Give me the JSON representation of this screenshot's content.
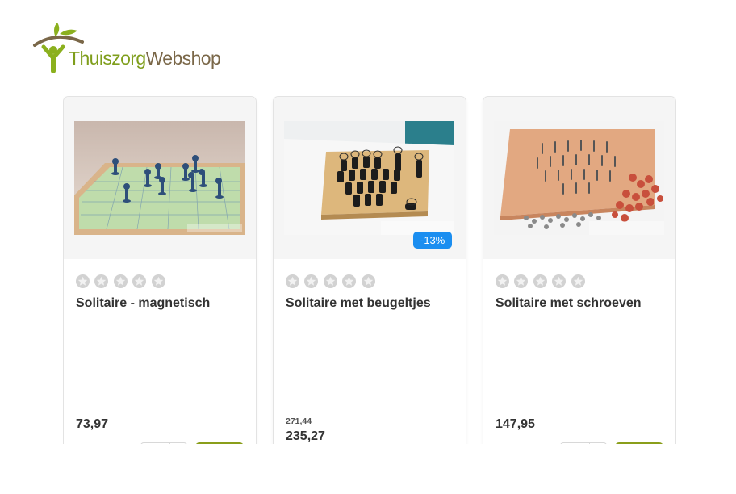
{
  "header": {
    "logo_part1": "Thuiszorg",
    "logo_part2": "Webshop"
  },
  "colors": {
    "brand_green": "#7f9e1c",
    "brand_brown": "#7a6748",
    "discount_badge": "#1b8ef0",
    "star_empty": "#d2d2d2",
    "cart_button": "#8a9e1a"
  },
  "products": [
    {
      "title": "Solitaire - magnetisch",
      "price": "73,97",
      "rating_stars": 0,
      "image": "magnetic-solitaire-board-photo"
    },
    {
      "title": "Solitaire met beugeltjes",
      "old_price": "271,44",
      "price": "235,27",
      "discount": "-13%",
      "rating_stars": 0,
      "image": "solitaire-with-handles-photo"
    },
    {
      "title": "Solitaire met schroeven",
      "price": "147,95",
      "rating_stars": 0,
      "image": "solitaire-with-screws-photo"
    }
  ]
}
